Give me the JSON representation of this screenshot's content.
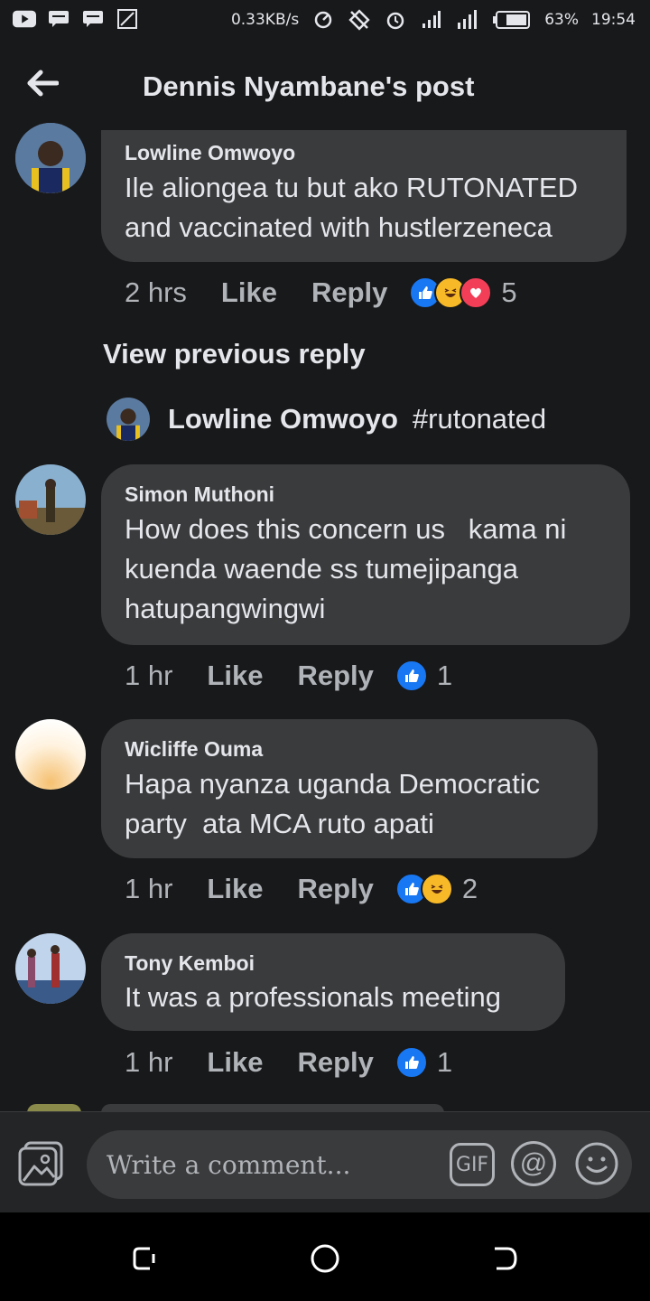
{
  "status_bar": {
    "speed": "0.33KB/s",
    "battery": "63%",
    "time": "19:54"
  },
  "header": {
    "title": "Dennis Nyambane's post"
  },
  "comments": [
    {
      "author": "Lowline Omwoyo",
      "lines": [
        "Ile aliongea tu but ako RUTONATED",
        "and vaccinated with hustlerzeneca"
      ],
      "time": "2 hrs",
      "like": "Like",
      "reply": "Reply",
      "reactions": [
        "like",
        "haha",
        "love"
      ],
      "count": "5"
    },
    {
      "author": "Simon Muthoni",
      "lines": [
        "How does this concern us   kama ni",
        "kuenda waende ss tumejipanga",
        "hatupangwingwi"
      ],
      "time": "1 hr",
      "like": "Like",
      "reply": "Reply",
      "reactions": [
        "like"
      ],
      "count": "1"
    },
    {
      "author": "Wicliffe Ouma",
      "lines": [
        "Hapa nyanza uganda Democratic",
        "party  ata MCA ruto apati"
      ],
      "time": "1 hr",
      "like": "Like",
      "reply": "Reply",
      "reactions": [
        "like",
        "haha"
      ],
      "count": "2"
    },
    {
      "author": "Tony Kemboi",
      "lines": [
        "It was a professionals meeting"
      ],
      "time": "1 hr",
      "like": "Like",
      "reply": "Reply",
      "reactions": [
        "like"
      ],
      "count": "1"
    }
  ],
  "view_previous": "View previous reply",
  "reply_preview": {
    "author": "Lowline Omwoyo",
    "text": "#rutonated"
  },
  "composer": {
    "placeholder": "Write a comment...",
    "gif": "GIF",
    "at": "@"
  },
  "colors": {
    "background": "#18191a",
    "bubble": "#3a3b3c",
    "like_blue": "#1877f2",
    "haha_yellow": "#f7b928",
    "love_red": "#f33e58"
  }
}
